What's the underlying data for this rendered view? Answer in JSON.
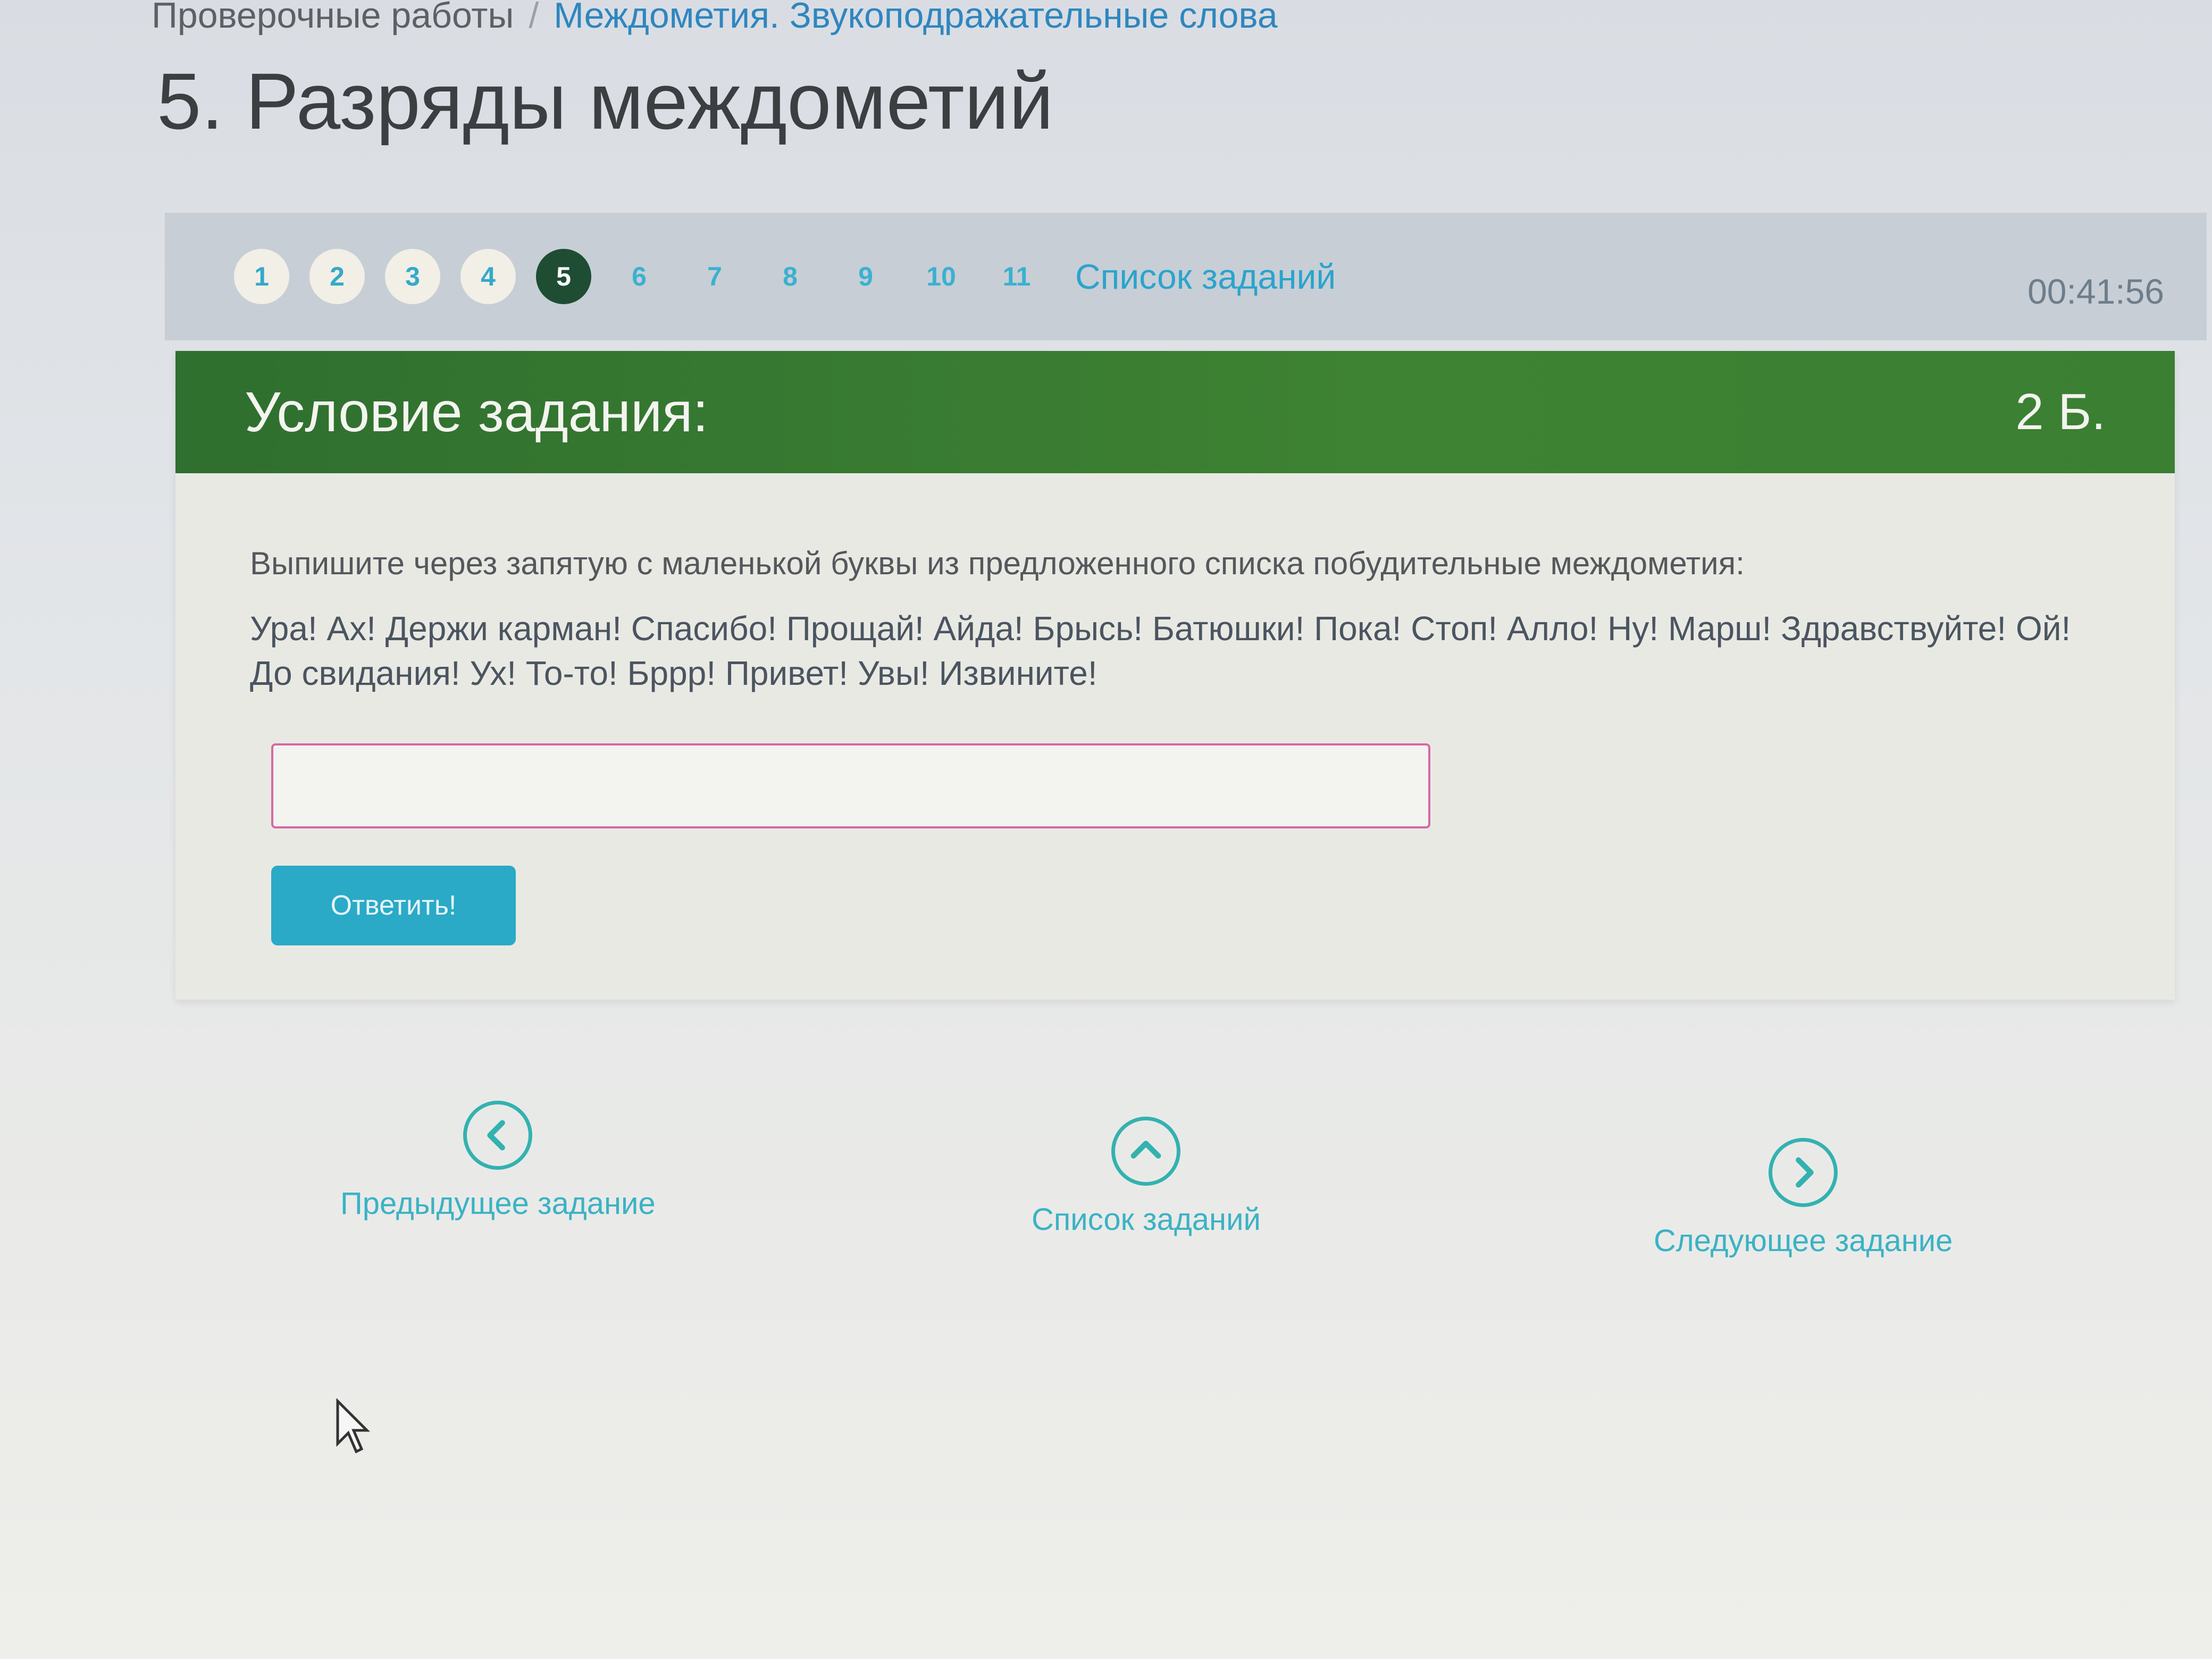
{
  "breadcrumb": {
    "parent": "Проверочные работы",
    "separator": "/",
    "current": "Междометия. Звукоподражательные слова"
  },
  "page_title": "5. Разряды междометий",
  "task_nav": {
    "numbers": [
      "1",
      "2",
      "3",
      "4",
      "5",
      "6",
      "7",
      "8",
      "9",
      "10",
      "11"
    ],
    "active": "5",
    "list_link": "Список заданий",
    "timer": "00:41:56"
  },
  "panel": {
    "title": "Условие задания:",
    "points": "2 Б.",
    "instruction": "Выпишите через запятую с маленькой буквы из предложенного списка побудительные междометия:",
    "word_list": "Ура! Ах! Держи карман! Спасибо! Прощай! Айда! Брысь! Батюшки! Пока! Стоп! Алло! Ну! Марш!  Здравствуйте!  Ой!  До свидания!  Ух! То-то! Бррр! Привет! Увы! Извините!",
    "input_value": "",
    "answer_button": "Ответить!"
  },
  "bottom_nav": {
    "prev": "Предыдущее задание",
    "list": "Список заданий",
    "next": "Следующее задание"
  },
  "colors": {
    "header_green": "#3e8233",
    "accent_teal": "#2aaac7",
    "active_step": "#1e4d34",
    "input_border": "#d36aa3"
  }
}
